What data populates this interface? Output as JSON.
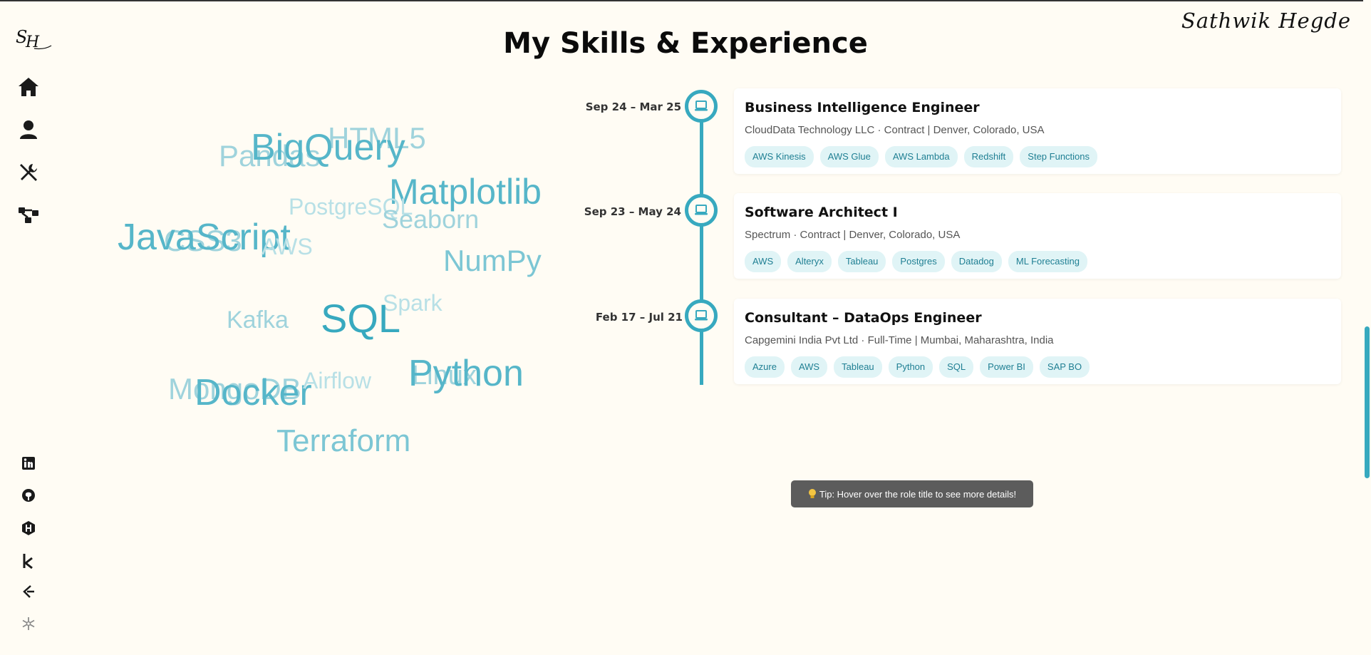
{
  "signature": "Sathwik Hegde",
  "page_title": "My Skills & Experience",
  "nav": {
    "logo_text": "SH",
    "items": [
      "home-icon",
      "user-icon",
      "tools-icon",
      "network-icon"
    ],
    "socials": [
      "linkedin-icon",
      "github-icon",
      "hackerrank-icon",
      "kaggle-icon",
      "leetcode-icon",
      "snowflake-icon"
    ]
  },
  "skills": [
    {
      "text": "HTML5",
      "color": "#9fd3dc"
    },
    {
      "text": "Pandas",
      "color": "#9fd3dc"
    },
    {
      "text": "BigQuery",
      "color": "#56b6c9"
    },
    {
      "text": "Matplotlib",
      "color": "#56b6c9"
    },
    {
      "text": "PostgreSQL",
      "color": "#b8e0e6"
    },
    {
      "text": "Seaborn",
      "color": "#9fd3dc"
    },
    {
      "text": "CSS3",
      "color": "#9fd3dc"
    },
    {
      "text": "JavaScript",
      "color": "#56b6c9"
    },
    {
      "text": "AWS",
      "color": "#b8e0e6"
    },
    {
      "text": "NumPy",
      "color": "#7cc6d4"
    },
    {
      "text": "Spark",
      "color": "#b8e0e6"
    },
    {
      "text": "Kafka",
      "color": "#9fd3dc"
    },
    {
      "text": "SQL",
      "color": "#37a9bf"
    },
    {
      "text": "MongoDB",
      "color": "#9fd3dc"
    },
    {
      "text": "Docker",
      "color": "#56b6c9"
    },
    {
      "text": "Airflow",
      "color": "#b8e0e6"
    },
    {
      "text": "Linux",
      "color": "#9fd3dc"
    },
    {
      "text": "Python",
      "color": "#56b6c9"
    },
    {
      "text": "Terraform",
      "color": "#7cc6d4"
    }
  ],
  "experience": [
    {
      "date": "Sep 24 – Mar 25",
      "role": "Business Intelligence Engineer",
      "company": "CloudData Technology LLC · Contract | Denver, Colorado, USA",
      "tags": [
        "AWS Kinesis",
        "AWS Glue",
        "AWS Lambda",
        "Redshift",
        "Step Functions"
      ]
    },
    {
      "date": "Sep 23 – May 24",
      "role": "Software Architect I",
      "company": "Spectrum · Contract | Denver, Colorado, USA",
      "tags": [
        "AWS",
        "Alteryx",
        "Tableau",
        "Postgres",
        "Datadog",
        "ML Forecasting"
      ]
    },
    {
      "date": "Feb 17 – Jul 21",
      "role": "Consultant – DataOps Engineer",
      "company": "Capgemini India Pvt Ltd · Full-Time | Mumbai, Maharashtra, India",
      "tags": [
        "Azure",
        "AWS",
        "Tableau",
        "Python",
        "SQL",
        "Power BI",
        "SAP BO"
      ]
    }
  ],
  "tip": "Tip: Hover over the role title to see more details!",
  "accent": "#37a9bf"
}
